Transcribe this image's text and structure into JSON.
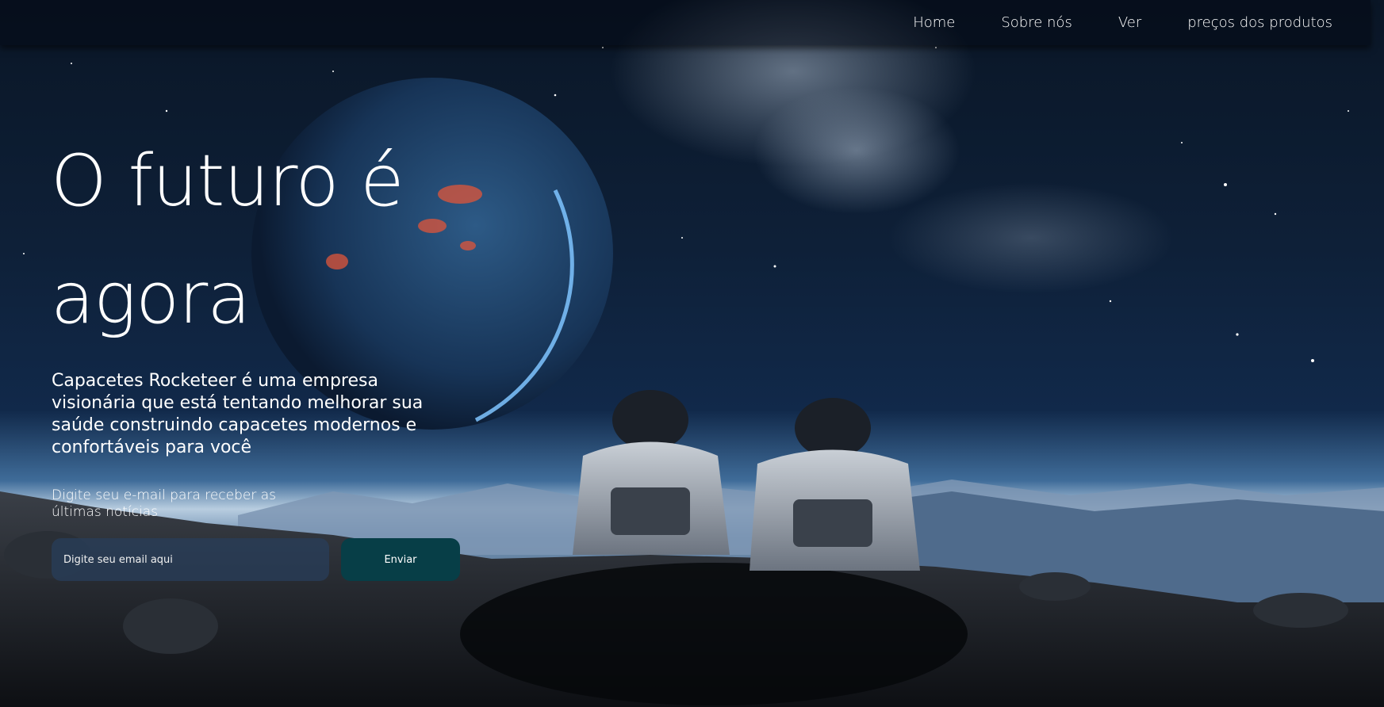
{
  "nav": {
    "items": [
      {
        "label": "Home"
      },
      {
        "label": "Sobre nós"
      },
      {
        "label": "Ver"
      },
      {
        "label": "preços dos produtos"
      }
    ]
  },
  "hero": {
    "headline": "O futuro é agora",
    "description": "Capacetes Rocketeer é uma empresa visionária que está tentando melhorar sua saúde construindo capacetes modernos e confortáveis para você",
    "newsletter_label": "Digite seu e-mail para receber as últimas notícias",
    "email_placeholder": "Digite seu email aqui",
    "submit_label": "Enviar"
  },
  "colors": {
    "button_bg": "#073e47",
    "input_bg": "#283e5c",
    "sky": "#0b1a30"
  }
}
